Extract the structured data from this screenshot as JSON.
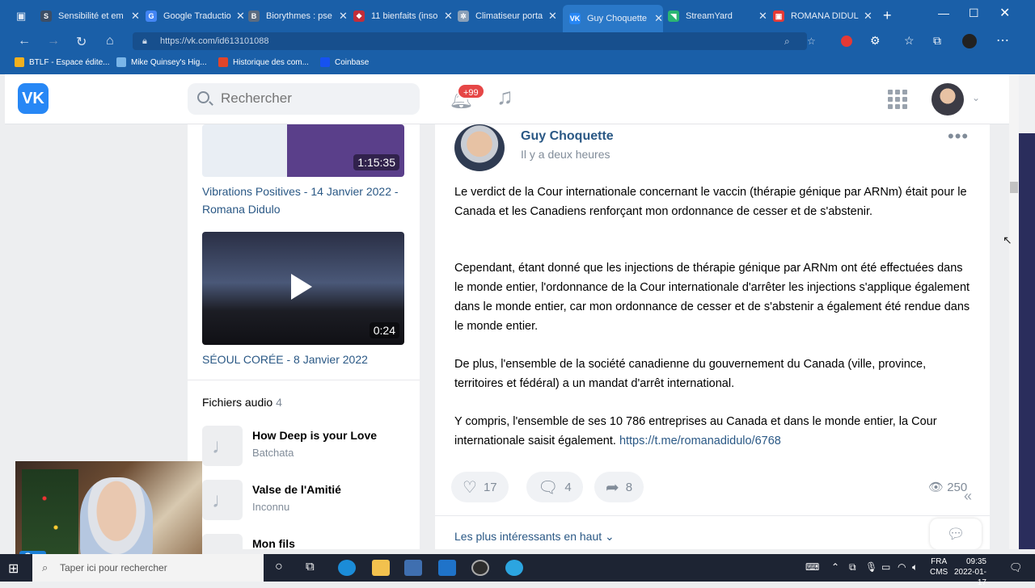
{
  "browser": {
    "tabs": [
      {
        "label": "Sensibilité et em",
        "color": "#3c4e66",
        "glyph": "S"
      },
      {
        "label": "Google Traductio",
        "color": "#4285f4",
        "glyph": "G"
      },
      {
        "label": "Biorythmes : pse",
        "color": "#5b6b80",
        "glyph": "B"
      },
      {
        "label": "11 bienfaits (inso",
        "color": "#c22d3a",
        "glyph": "❖"
      },
      {
        "label": "Climatiseur porta",
        "color": "#8aa0b8",
        "glyph": "✲"
      },
      {
        "label": "Guy Choquette",
        "color": "#2787f5",
        "glyph": "VK"
      },
      {
        "label": "StreamYard",
        "color": "#2bb673",
        "glyph": "◥"
      },
      {
        "label": "ROMANA DIDUL",
        "color": "#e53935",
        "glyph": "▣"
      }
    ],
    "url": "https://vk.com/id613101088",
    "bookmarks": [
      {
        "label": "BTLF - Espace édite...",
        "color": "#f2b01e"
      },
      {
        "label": "Mike Quinsey's Hig...",
        "color": "#7ab5e8"
      },
      {
        "label": "Historique des com...",
        "color": "#e0452b"
      },
      {
        "label": "Coinbase",
        "color": "#1652f0"
      }
    ]
  },
  "vk": {
    "logo": "VK",
    "search_placeholder": "Rechercher",
    "notif_badge": "+99"
  },
  "left": {
    "videos": [
      {
        "duration": "1:15:35",
        "title": "Vibrations Positives - 14 Janvier 2022 - Romana Didulo"
      },
      {
        "duration": "0:24",
        "title": "SÉOUL CORÉE - 8 Janvier 2022"
      }
    ],
    "audio_title": "Fichiers audio",
    "audio_count": "4",
    "tracks": [
      {
        "title": "How Deep is your Love",
        "artist": "Batchata"
      },
      {
        "title": "Valse de l'Amitié",
        "artist": "Inconnu"
      },
      {
        "title": "Mon fils",
        "artist": ""
      }
    ]
  },
  "post": {
    "author": "Guy Choquette",
    "time": "Il y a deux heures",
    "p1": "Le verdict de la Cour internationale concernant le vaccin (thérapie génique par ARNm) était pour le Canada et les Canadiens renforçant mon ordonnance de cesser et de s'abstenir.",
    "p2": "Cependant, étant donné que les injections de thérapie génique par ARNm ont été effectuées dans le monde entier, l'ordonnance de la Cour internationale d'arrêter les injections s'applique également dans le monde entier, car mon ordonnance de cesser et de s'abstenir a également été rendue dans le monde entier.",
    "p3": "De plus, l'ensemble de la société canadienne du gouvernement du Canada (ville, province, territoires et fédéral) a un mandat d'arrêt international.",
    "p4": "Y compris, l'ensemble de ses 10 786 entreprises au Canada et dans le monde entier, la Cour internationale saisit également.",
    "link": "https://t.me/romanadidulo/6768",
    "likes": "17",
    "comments": "4",
    "shares": "8",
    "views": "250",
    "sort_label": "Les plus intéressants en haut ⌄"
  },
  "webcam": {
    "name": "Guy"
  },
  "taskbar": {
    "search_placeholder": "Taper ici pour rechercher",
    "lang1": "FRA",
    "lang2": "CMS",
    "time": "09:35",
    "date": "2022-01-17"
  }
}
